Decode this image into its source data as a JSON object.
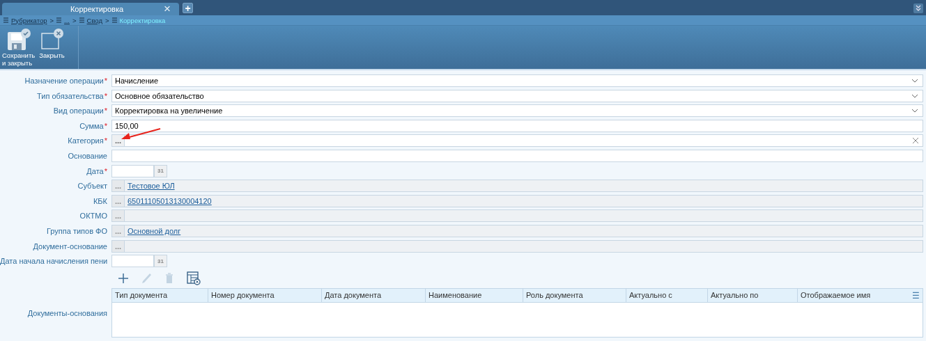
{
  "tab": {
    "title": "Корректировка",
    "close": "×",
    "add": "+"
  },
  "breadcrumb": {
    "separator": ">",
    "items": [
      {
        "label": "Рубрикатор",
        "current": false
      },
      {
        "label": "...",
        "current": false
      },
      {
        "label": "Свод",
        "current": false
      },
      {
        "label": "Корректировка",
        "current": true
      }
    ]
  },
  "toolbar": [
    {
      "label": "Сохранить\nи закрыть",
      "kind": "save"
    },
    {
      "label": "Закрыть",
      "kind": "close"
    }
  ],
  "required_mark": "*",
  "fields": [
    {
      "label": "Назначение операции",
      "required": true,
      "kind": "select",
      "value": "Начисление"
    },
    {
      "label": "Тип обязательства",
      "required": true,
      "kind": "select",
      "value": "Основное обязательство"
    },
    {
      "label": "Вид операции",
      "required": true,
      "kind": "select",
      "value": "Корректировка на увеличение"
    },
    {
      "label": "Сумма",
      "required": true,
      "kind": "text",
      "value": "150,00"
    },
    {
      "label": "Категория",
      "required": true,
      "kind": "lookup",
      "button": "...",
      "clearable": true,
      "disabled": false,
      "annotated": true
    },
    {
      "label": "Основание",
      "required": false,
      "kind": "text"
    },
    {
      "label": "Дата",
      "required": true,
      "kind": "date",
      "button": "31"
    },
    {
      "label": "Субъект",
      "required": false,
      "kind": "lookup",
      "button": "...",
      "value": "Тестовое ЮЛ",
      "disabled": true
    },
    {
      "label": "КБК",
      "required": false,
      "kind": "lookup",
      "button": "...",
      "value": "65011105013130004120",
      "disabled": true
    },
    {
      "label": "ОКТМО",
      "required": false,
      "kind": "lookup",
      "button": "...",
      "disabled": true
    },
    {
      "label": "Группа типов ФО",
      "required": false,
      "kind": "lookup",
      "button": "...",
      "value": "Основной долг",
      "disabled": true
    },
    {
      "label": "Документ-основание",
      "required": false,
      "kind": "lookup",
      "button": "...",
      "disabled": true
    },
    {
      "label": "Дата начала начисления пени",
      "required": false,
      "kind": "date",
      "button": "31"
    }
  ],
  "grid_tools": [
    {
      "kind": "add",
      "disabled": false
    },
    {
      "kind": "edit",
      "disabled": true
    },
    {
      "kind": "delete",
      "disabled": true
    },
    {
      "kind": "settings",
      "disabled": false
    }
  ],
  "table": {
    "label": "Документы-основания",
    "menu": "☰",
    "columns": [
      "Тип документа",
      "Номер документа",
      "Дата документа",
      "Наименование",
      "Роль документа",
      "Актуально с",
      "Актуально по",
      "Отображаемое имя"
    ]
  }
}
